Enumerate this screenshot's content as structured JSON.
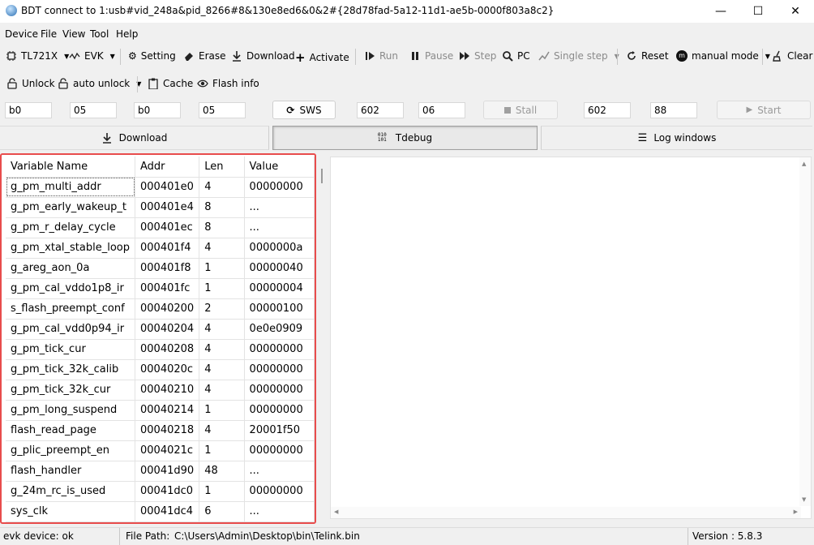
{
  "window": {
    "title": "BDT connect to 1:usb#vid_248a&pid_8266#8&130e8ed6&0&2#{28d78fad-5a12-11d1-ae5b-0000f803a8c2}",
    "minimize_glyph": "—",
    "maximize_glyph": "☐",
    "close_glyph": "✕"
  },
  "menu": [
    "Device",
    "File",
    "View",
    "Tool",
    "Help"
  ],
  "toolbar1": {
    "chip": "TL721X",
    "board": "EVK",
    "setting": "Setting",
    "erase": "Erase",
    "download": "Download",
    "activate": "Activate",
    "run": "Run",
    "pause": "Pause",
    "step": "Step",
    "pc": "PC",
    "single_step": "Single step",
    "reset": "Reset",
    "mode": "manual mode",
    "clear": "Clear"
  },
  "toolbar2": {
    "unlock": "Unlock",
    "auto_unlock": "auto unlock",
    "cache": "Cache",
    "flash_info": "Flash info"
  },
  "row3": {
    "field1": "b0",
    "field2": "05",
    "field3": "b0",
    "field4": "05",
    "sws": "SWS",
    "field5": "602",
    "field6": "06",
    "stall": "Stall",
    "field7": "602",
    "field8": "88",
    "start": "Start"
  },
  "tabs": {
    "download": "Download",
    "tdebug": "Tdebug",
    "log": "Log windows"
  },
  "table": {
    "columns": [
      "Variable Name",
      "Addr",
      "Len",
      "Value"
    ],
    "rows": [
      [
        "g_pm_multi_addr",
        "000401e0",
        "4",
        "00000000"
      ],
      [
        "g_pm_early_wakeup_t",
        "000401e4",
        "8",
        "..."
      ],
      [
        "g_pm_r_delay_cycle",
        "000401ec",
        "8",
        "..."
      ],
      [
        "g_pm_xtal_stable_loop",
        "000401f4",
        "4",
        "0000000a"
      ],
      [
        "g_areg_aon_0a",
        "000401f8",
        "1",
        "00000040"
      ],
      [
        "g_pm_cal_vddo1p8_ir",
        "000401fc",
        "1",
        "00000004"
      ],
      [
        "s_flash_preempt_conf",
        "00040200",
        "2",
        "00000100"
      ],
      [
        "g_pm_cal_vdd0p94_ir",
        "00040204",
        "4",
        "0e0e0909"
      ],
      [
        "g_pm_tick_cur",
        "00040208",
        "4",
        "00000000"
      ],
      [
        "g_pm_tick_32k_calib",
        "0004020c",
        "4",
        "00000000"
      ],
      [
        "g_pm_tick_32k_cur",
        "00040210",
        "4",
        "00000000"
      ],
      [
        "g_pm_long_suspend",
        "00040214",
        "1",
        "00000000"
      ],
      [
        "flash_read_page",
        "00040218",
        "4",
        "20001f50"
      ],
      [
        "g_plic_preempt_en",
        "0004021c",
        "1",
        "00000000"
      ],
      [
        "flash_handler",
        "00041d90",
        "48",
        "..."
      ],
      [
        "g_24m_rc_is_used",
        "00041dc0",
        "1",
        "00000000"
      ],
      [
        "sys_clk",
        "00041dc4",
        "6",
        "..."
      ]
    ]
  },
  "status": {
    "device": "evk device: ok",
    "file_path_label": "File Path:",
    "file_path": "C:\\Users\\Admin\\Desktop\\bin\\Telink.bin",
    "version": "Version : 5.8.3"
  },
  "colors": {
    "highlight_border": "#e84c4c",
    "background": "#f0f0f0"
  }
}
